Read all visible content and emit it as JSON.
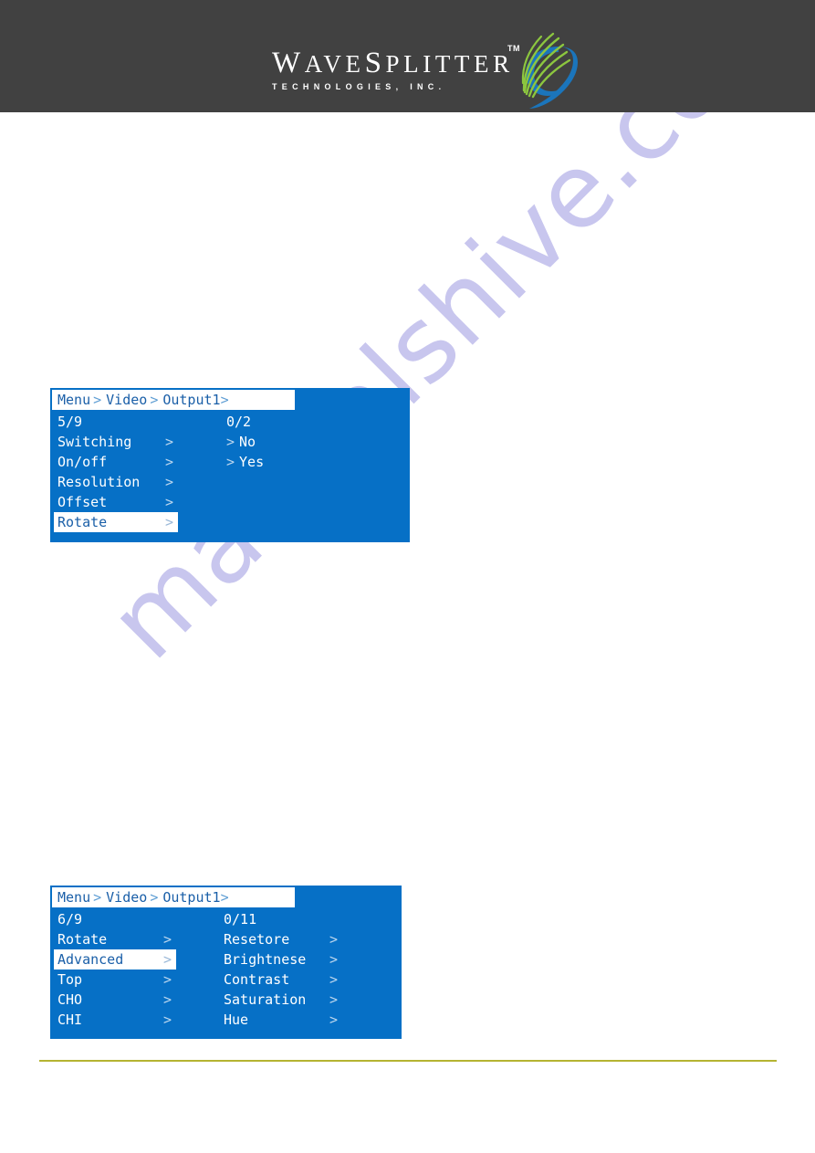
{
  "header": {
    "brand_name_parts": [
      "W",
      "AVE",
      "S",
      "PLITTER"
    ],
    "brand_name": "WAVESPLITTER",
    "tagline": "TECHNOLOGIES, INC.",
    "trademark": "TM",
    "background_color": "#414141",
    "logo_green": "#8cc63f",
    "logo_blue": "#1b75bb"
  },
  "watermark": {
    "text": "manualshive.com",
    "color": "#c8c6ee"
  },
  "osd_panels": [
    {
      "id": "panel-1",
      "background_color": "#0670c6",
      "breadcrumb": {
        "root": "Menu",
        "level2": "Video",
        "level3": "Output1",
        "separator": ">"
      },
      "counter_left": "5/9",
      "counter_right": "0/2",
      "rows": [
        {
          "label": "Switching",
          "chevron": ">",
          "value_chevron": ">",
          "value": "No",
          "highlight": false
        },
        {
          "label": "On/off",
          "chevron": ">",
          "value_chevron": ">",
          "value": "Yes",
          "highlight": false
        },
        {
          "label": "Resolution",
          "chevron": ">",
          "value_chevron": "",
          "value": "",
          "highlight": false
        },
        {
          "label": "Offset",
          "chevron": ">",
          "value_chevron": "",
          "value": "",
          "highlight": false
        },
        {
          "label": "Rotate",
          "chevron": ">",
          "value_chevron": "",
          "value": "",
          "highlight": true
        }
      ]
    },
    {
      "id": "panel-2",
      "background_color": "#0670c6",
      "breadcrumb": {
        "root": "Menu",
        "level2": "Video",
        "level3": "Output1",
        "separator": ">"
      },
      "counter_left": "6/9",
      "counter_right": "0/11",
      "rows": [
        {
          "label": "Rotate",
          "chevron": ">",
          "value_chevron": "",
          "value": "Resetore",
          "third_chevron": ">",
          "highlight": false
        },
        {
          "label": "Advanced",
          "chevron": ">",
          "value_chevron": "",
          "value": "Brightnese",
          "third_chevron": ">",
          "highlight": true
        },
        {
          "label": "Top",
          "chevron": ">",
          "value_chevron": "",
          "value": "Contrast",
          "third_chevron": ">",
          "highlight": false
        },
        {
          "label": "CHO",
          "chevron": ">",
          "value_chevron": "",
          "value": "Saturation",
          "third_chevron": ">",
          "highlight": false
        },
        {
          "label": "CHI",
          "chevron": ">",
          "value_chevron": "",
          "value": "Hue",
          "third_chevron": ">",
          "highlight": false
        }
      ]
    }
  ],
  "footer": {
    "rule_color": "#b5b432"
  }
}
